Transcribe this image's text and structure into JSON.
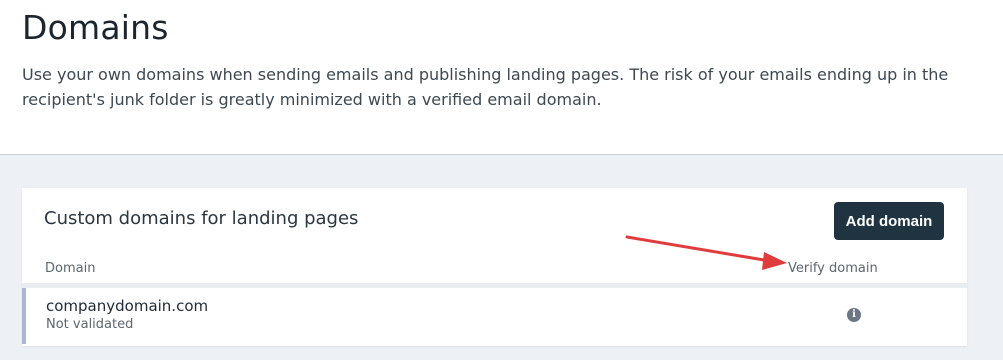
{
  "page": {
    "title": "Domains",
    "description": "Use your own domains when sending emails and publishing landing pages. The risk of your emails ending up in the recipient's junk folder is greatly minimized with a verified email domain."
  },
  "card": {
    "title": "Custom domains for landing pages",
    "add_button_label": "Add domain",
    "columns": {
      "domain": "Domain",
      "verify": "Verify domain"
    },
    "rows": [
      {
        "domain": "companydomain.com",
        "status": "Not validated",
        "verify_icon": "info-icon"
      }
    ]
  },
  "annotation": {
    "arrow_color": "#e03c3c"
  },
  "colors": {
    "button_bg": "#1f3440",
    "page_bg": "#edf0f4",
    "row_accent": "#a9b8cf"
  }
}
